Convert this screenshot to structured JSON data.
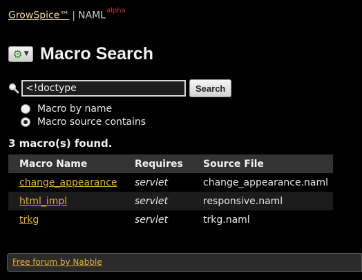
{
  "header": {
    "brand": "GrowSpice™",
    "separator": "|",
    "product": "NAML",
    "stage": "alpha"
  },
  "title": {
    "menu_icon": "gear-icon",
    "text": "Macro Search"
  },
  "search": {
    "icon": "magnifier-icon",
    "value": "<!doctype",
    "button_label": "Search",
    "options": [
      {
        "label": "Macro by name",
        "checked": false
      },
      {
        "label": "Macro source contains",
        "checked": true
      }
    ]
  },
  "results": {
    "summary": "3 macro(s) found.",
    "columns": [
      "Macro Name",
      "Requires",
      "Source File"
    ],
    "rows": [
      {
        "name": "change_appearance",
        "requires": "servlet",
        "source": "change_appearance.naml"
      },
      {
        "name": "html_impl",
        "requires": "servlet",
        "source": "responsive.naml"
      },
      {
        "name": "trkg",
        "requires": "servlet",
        "source": "trkg.naml"
      }
    ]
  },
  "footer": {
    "link": "Free forum by Nabble"
  },
  "colors": {
    "link": "#e0b23a",
    "gear": "#3d8b2f",
    "alpha": "#c0392b"
  }
}
